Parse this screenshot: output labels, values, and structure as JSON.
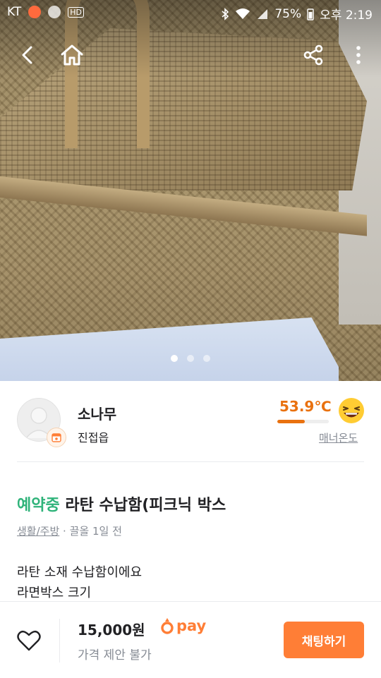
{
  "status_bar": {
    "carrier": "KT",
    "battery": "75%",
    "time": "오후 2:19",
    "icons": [
      "notification-icon",
      "talk-icon",
      "hd-icon",
      "bluetooth-icon",
      "wifi-icon",
      "signal-icon"
    ]
  },
  "top_nav": {
    "back_icon": "back-arrow-icon",
    "home_icon": "home-icon",
    "share_icon": "share-icon",
    "more_icon": "more-vertical-icon"
  },
  "carousel": {
    "page_count": 3,
    "active_index": 0
  },
  "seller": {
    "name": "소나무",
    "location": "진접읍",
    "manner_temperature": "53.9℃",
    "manner_temperature_fill": 0.54,
    "manner_label": "매너온도"
  },
  "listing": {
    "status": "예약중",
    "title": "라탄 수납함(피크닉 박스",
    "category": "생활/주방",
    "separator": "·",
    "bumped": "끌올 1일 전",
    "description_lines": [
      "라탄 소재 수납함이에요",
      "라면박스 크기"
    ]
  },
  "bottom_bar": {
    "price": "15,000원",
    "pay_label": "pay",
    "price_note": "가격 제안 불가",
    "chat_button": "채팅하기"
  },
  "colors": {
    "brand_orange": "#ff7e36",
    "temperature_orange": "#e9710f",
    "reserved_green": "#2fb37a",
    "muted_gray": "#868b94"
  }
}
